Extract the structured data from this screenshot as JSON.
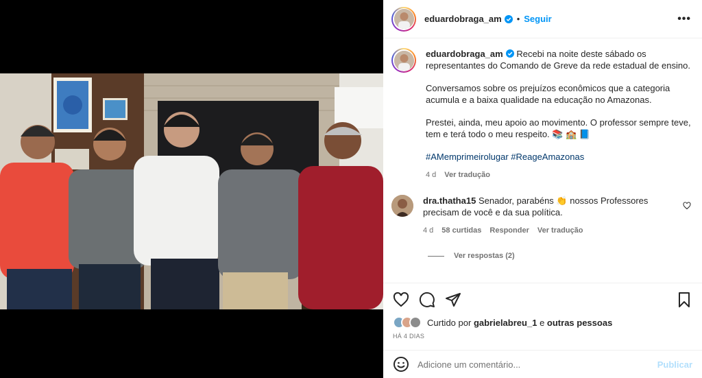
{
  "post": {
    "username": "eduardobraga_am",
    "follow_label": "Seguir",
    "dot": "•",
    "caption_intro": "Recebi na noite deste sábado os representantes do Comando de Greve da rede estadual de ensino.",
    "caption_p2": "Conversamos sobre os prejuízos econômicos que a categoria acumula e a baixa qualidade na educação no Amazonas.",
    "caption_p3": "Prestei, ainda, meu apoio ao movimento. O professor sempre teve, tem e terá todo o meu respeito. 📚 🏫 📘",
    "hashtags": "#AMemprimeirolugar #ReageAmazonas",
    "age": "4 d",
    "see_translation": "Ver tradução"
  },
  "comment": {
    "username": "dra.thatha15",
    "text": "Senador, parabéns 👏 nossos Professores precisam de você e da sua política.",
    "age": "4 d",
    "likes": "58 curtidas",
    "reply": "Responder",
    "translate": "Ver tradução",
    "view_replies": "Ver respostas (2)"
  },
  "likes": {
    "prefix": "Curtido por",
    "user": "gabrielabreu_1",
    "conj": "e",
    "others": "outras pessoas"
  },
  "timestamp": "HÁ 4 DIAS",
  "add_comment": {
    "placeholder": "Adicione um comentário...",
    "publish": "Publicar"
  },
  "colors": {
    "accent": "#0095f6",
    "hashtag": "#00376b",
    "muted": "#737373"
  }
}
